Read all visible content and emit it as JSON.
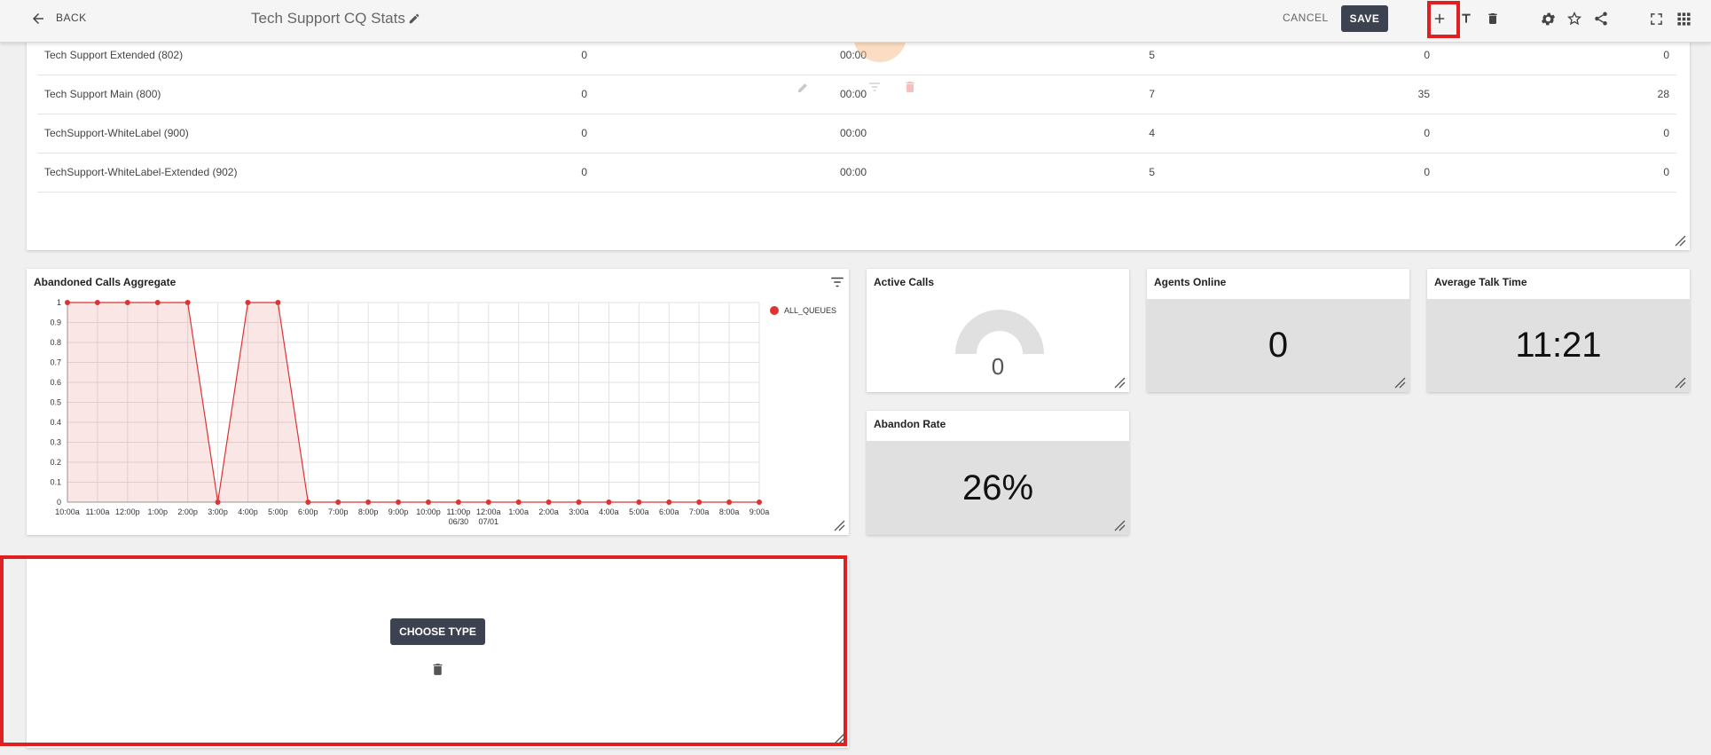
{
  "topbar": {
    "back_label": "BACK",
    "title": "Tech Support CQ Stats",
    "cancel_label": "CANCEL",
    "save_label": "SAVE"
  },
  "table": {
    "rows": [
      {
        "name": "Tech Support Extended (802)",
        "c1": "0",
        "c2": "00:00",
        "c3": "5",
        "c4": "0",
        "c5": "0"
      },
      {
        "name": "Tech Support Main (800)",
        "c1": "0",
        "c2": "00:00",
        "c3": "7",
        "c4": "35",
        "c5": "28"
      },
      {
        "name": "TechSupport-WhiteLabel (900)",
        "c1": "0",
        "c2": "00:00",
        "c3": "4",
        "c4": "0",
        "c5": "0"
      },
      {
        "name": "TechSupport-WhiteLabel-Extended (902)",
        "c1": "0",
        "c2": "00:00",
        "c3": "5",
        "c4": "0",
        "c5": "0"
      }
    ]
  },
  "abandoned_card": {
    "title": "Abandoned Calls Aggregate"
  },
  "active_calls": {
    "title": "Active Calls",
    "value": "0",
    "gauge_fraction": 0
  },
  "agents_online": {
    "title": "Agents Online",
    "value": "0"
  },
  "avg_talk": {
    "title": "Average Talk Time",
    "value": "11:21"
  },
  "abandon_rate": {
    "title": "Abandon Rate",
    "value": "26%"
  },
  "new_widget": {
    "choose_label": "CHOOSE TYPE"
  },
  "chart_data": {
    "type": "area",
    "title": "Abandoned Calls Aggregate",
    "x": [
      "10:00a",
      "11:00a",
      "12:00p",
      "1:00p",
      "2:00p",
      "3:00p",
      "4:00p",
      "5:00p",
      "6:00p",
      "7:00p",
      "8:00p",
      "9:00p",
      "10:00p",
      "11:00p",
      "12:00a",
      "1:00a",
      "2:00a",
      "3:00a",
      "4:00a",
      "5:00a",
      "6:00a",
      "7:00a",
      "8:00a",
      "9:00a"
    ],
    "x_sublabels": {
      "11:00p": "06/30",
      "12:00a": "07/01"
    },
    "yticks": [
      "0",
      "0.1",
      "0.2",
      "0.3",
      "0.4",
      "0.5",
      "0.6",
      "0.7",
      "0.8",
      "0.9",
      "1"
    ],
    "ylim": [
      0,
      1
    ],
    "series": [
      {
        "name": "ALL_QUEUES",
        "color": "#dd3333",
        "values": [
          1,
          1,
          1,
          1,
          1,
          0,
          1,
          1,
          0,
          0,
          0,
          0,
          0,
          0,
          0,
          0,
          0,
          0,
          0,
          0,
          0,
          0,
          0,
          0
        ]
      }
    ],
    "legend": "top-right",
    "grid": true
  },
  "colors": {
    "accent": "#e02020",
    "button_dark": "#3d4250",
    "series": "#dd3333"
  }
}
